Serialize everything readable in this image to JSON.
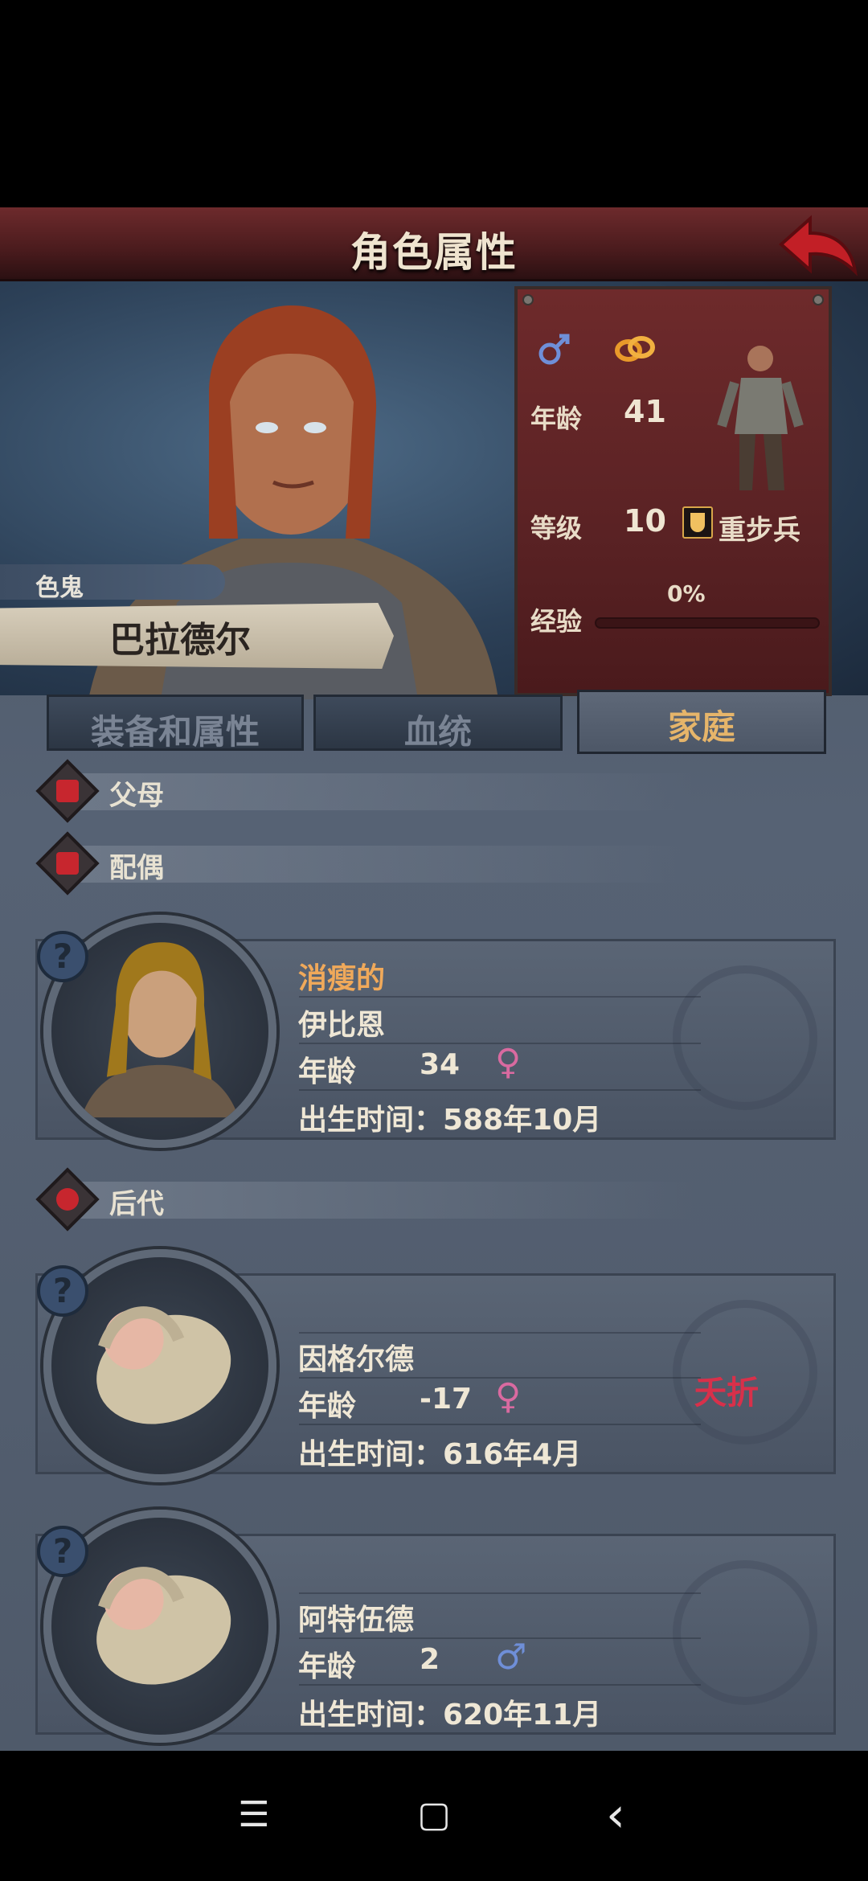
{
  "header": {
    "title": "角色属性"
  },
  "hero": {
    "trait": "色鬼",
    "name": "巴拉德尔"
  },
  "stats": {
    "gender_icon": "male-symbol",
    "marriage_icon": "rings-icon",
    "age_label": "年龄",
    "age": "41",
    "level_label": "等级",
    "level": "10",
    "unit_type": "重步兵",
    "xp_label": "经验",
    "xp_percent": "0%",
    "xp_fraction": 0
  },
  "tabs": [
    {
      "label": "装备和属性",
      "active": false
    },
    {
      "label": "血统",
      "active": false
    },
    {
      "label": "家庭",
      "active": true
    }
  ],
  "sections": {
    "parents": "父母",
    "spouse": "配偶",
    "children": "后代"
  },
  "spouse": {
    "trait": "消瘦的",
    "name": "伊比恩",
    "age_label": "年龄",
    "age": "34",
    "gender_symbol": "♀",
    "birth": "出生时间：588年10月"
  },
  "children": [
    {
      "name": "因格尔德",
      "age_label": "年龄",
      "age": "-17",
      "gender_symbol": "♀",
      "birth": "出生时间：616年4月",
      "status": "夭折"
    },
    {
      "name": "阿特伍德",
      "age_label": "年龄",
      "age": "2",
      "gender_symbol": "♂",
      "birth": "出生时间：620年11月",
      "status": ""
    }
  ],
  "help_symbol": "?",
  "nav": {
    "menu": "☰",
    "home": "▢",
    "back": "‹"
  },
  "colors": {
    "accent_tab": "#e6b56a",
    "death_status": "#d8304a",
    "female": "#d96aa0",
    "male": "#6f8fd8"
  }
}
